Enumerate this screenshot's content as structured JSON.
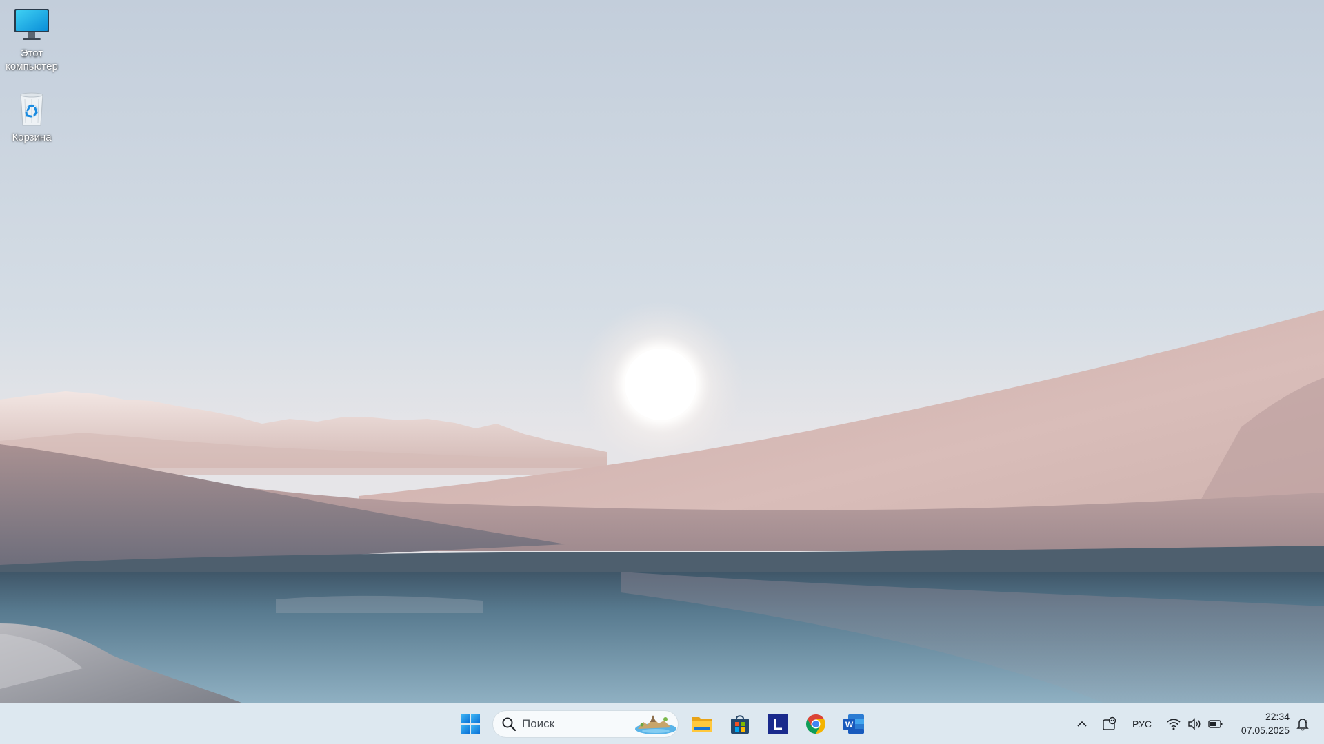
{
  "desktop": {
    "icons": [
      {
        "label": "Этот компьютер",
        "icon": "monitor-icon"
      },
      {
        "label": "Корзина",
        "icon": "recycle-bin-icon"
      }
    ]
  },
  "taskbar": {
    "start_icon": "windows-start-icon",
    "search": {
      "placeholder": "Поиск",
      "icon": "search-icon"
    },
    "pinned": [
      {
        "name": "file-explorer",
        "icon": "folder-icon"
      },
      {
        "name": "microsoft-store",
        "icon": "store-icon"
      },
      {
        "name": "l-app",
        "icon": "l-app-icon",
        "letter": "L"
      },
      {
        "name": "google-chrome",
        "icon": "chrome-icon"
      },
      {
        "name": "microsoft-word",
        "icon": "word-icon",
        "letter": "W"
      }
    ],
    "tray": {
      "language": "РУС",
      "time": "22:34",
      "date": "07.05.2025"
    }
  },
  "colors": {
    "taskbar_bg": "#dde8f0",
    "windows_blue": "#0078d4",
    "word_blue": "#185abd"
  }
}
